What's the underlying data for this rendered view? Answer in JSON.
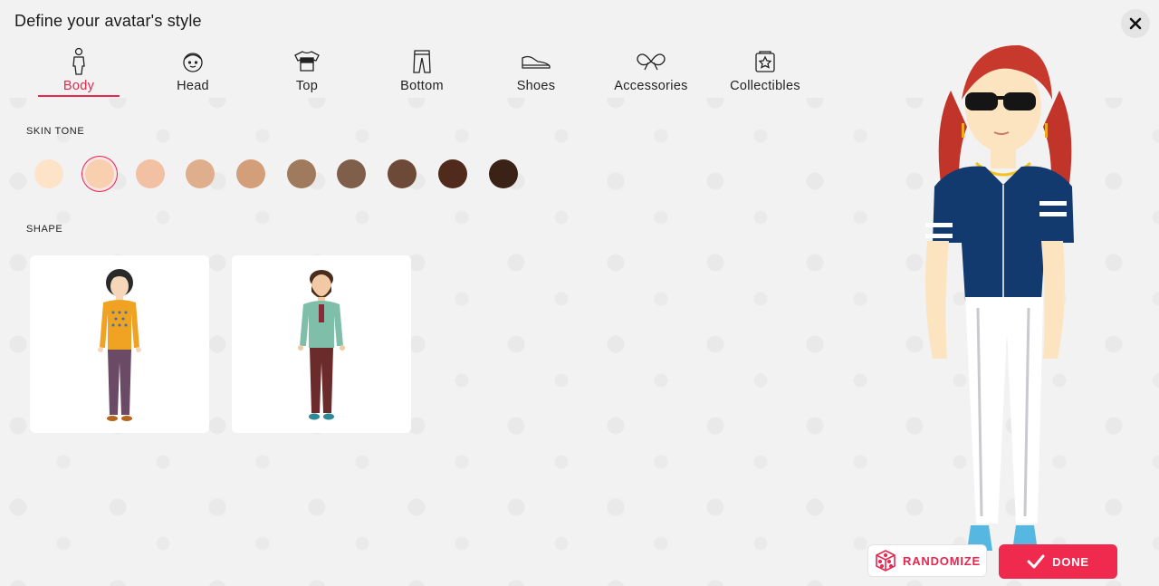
{
  "title": "Define your avatar's style",
  "tabs": [
    {
      "label": "Body",
      "icon": "body-icon",
      "active": true
    },
    {
      "label": "Head",
      "icon": "head-icon",
      "active": false
    },
    {
      "label": "Top",
      "icon": "top-icon",
      "active": false
    },
    {
      "label": "Bottom",
      "icon": "bottom-icon",
      "active": false
    },
    {
      "label": "Shoes",
      "icon": "shoes-icon",
      "active": false
    },
    {
      "label": "Accessories",
      "icon": "accessories-icon",
      "active": false
    },
    {
      "label": "Collectibles",
      "icon": "collectibles-icon",
      "active": false
    }
  ],
  "skin_tone": {
    "label": "SKIN TONE",
    "selected_index": 1,
    "colors": [
      "#fde4c8",
      "#f8d0b0",
      "#f2c0a3",
      "#dfae8c",
      "#d29f7a",
      "#a07a5c",
      "#7f5f4a",
      "#6d4a37",
      "#4f2a1d",
      "#3a2216"
    ]
  },
  "shape": {
    "label": "SHAPE",
    "options": [
      "feminine-shape",
      "masculine-shape"
    ]
  },
  "buttons": {
    "randomize": "RANDOMIZE",
    "done": "DONE"
  },
  "colors": {
    "accent": "#e8264e",
    "done_bg": "#f0294f"
  }
}
